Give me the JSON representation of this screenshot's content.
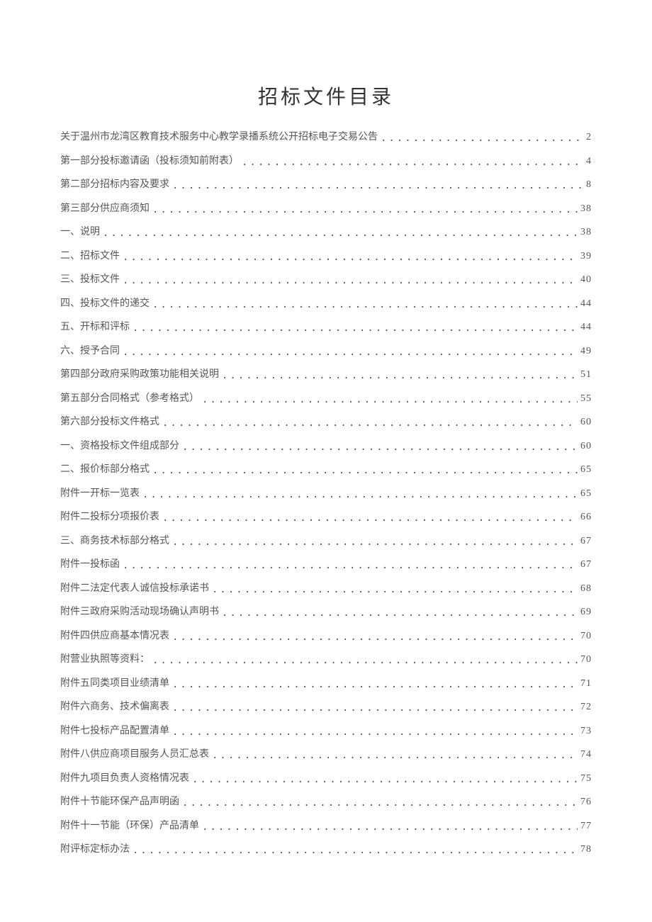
{
  "title": "招标文件目录",
  "toc": [
    {
      "label": "关于温州市龙湾区教育技术服务中心教学录播系统公开招标电子交易公告",
      "page": "2"
    },
    {
      "label": "第一部分投标邀请函（投标须知前附表）",
      "page": "4"
    },
    {
      "label": "第二部分招标内容及要求",
      "page": "8"
    },
    {
      "label": "第三部分供应商须知",
      "page": "38"
    },
    {
      "label": "一、说明",
      "page": "38"
    },
    {
      "label": "二、招标文件",
      "page": "39"
    },
    {
      "label": "三、投标文件",
      "page": "40"
    },
    {
      "label": "四、投标文件的递交",
      "page": "44"
    },
    {
      "label": "五、开标和评标",
      "page": "44"
    },
    {
      "label": "六、授予合同",
      "page": "49"
    },
    {
      "label": "第四部分政府采购政策功能相关说明",
      "page": "51"
    },
    {
      "label": "第五部分合同格式（参考格式）",
      "page": "55"
    },
    {
      "label": "第六部分投标文件格式",
      "page": "60"
    },
    {
      "label": "一、资格投标文件组成部分",
      "page": "60"
    },
    {
      "label": "二、报价标部分格式",
      "page": "65"
    },
    {
      "label": "附件一开标一览表",
      "page": "65"
    },
    {
      "label": "附件二投标分项报价表",
      "page": "66"
    },
    {
      "label": "三、商务技术标部分格式",
      "page": "67"
    },
    {
      "label": "附件一投标函",
      "page": "67"
    },
    {
      "label": "附件二法定代表人诚信投标承诺书",
      "page": "68"
    },
    {
      "label": "附件三政府采购活动现场确认声明书",
      "page": "69"
    },
    {
      "label": "附件四供应商基本情况表",
      "page": "70"
    },
    {
      "label": "附营业执照等资料：",
      "page": "70"
    },
    {
      "label": "附件五同类项目业绩清单",
      "page": "71"
    },
    {
      "label": "附件六商务、技术偏离表",
      "page": "72"
    },
    {
      "label": "附件七投标产品配置清单",
      "page": "73"
    },
    {
      "label": "附件八供应商项目服务人员汇总表",
      "page": "74"
    },
    {
      "label": "附件九项目负责人资格情况表",
      "page": "75"
    },
    {
      "label": "附件十节能环保产品声明函",
      "page": "76"
    },
    {
      "label": "附件十一节能（环保）产品清单",
      "page": "77"
    },
    {
      "label": "附评标定标办法",
      "page": "78"
    }
  ]
}
